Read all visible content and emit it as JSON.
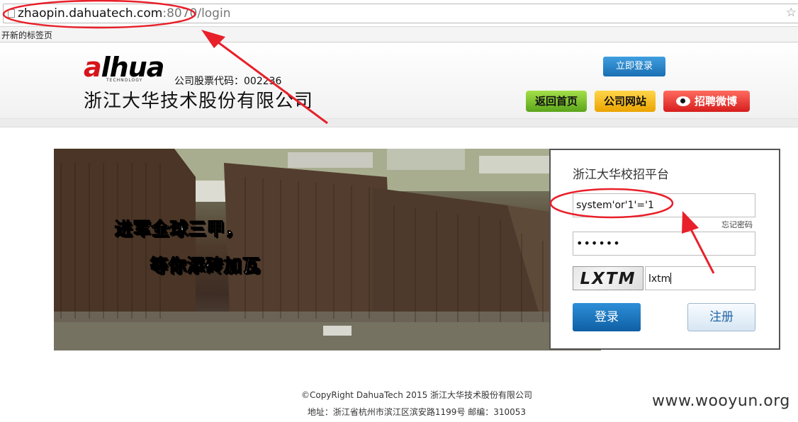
{
  "browser": {
    "url_host": "zhaopin.dahuatech.com",
    "url_rest": ":8070/login",
    "bookmark_label": "开新的标签页"
  },
  "header": {
    "logo_a": "a",
    "logo_rest": "lhua",
    "logo_sub": "TECHNOLOGY",
    "stock_code": "公司股票代码：002236",
    "company_name": "浙江大华技术股份有限公司",
    "login_now": "立即登录",
    "nav": {
      "home": "返回首页",
      "website": "公司网站",
      "weibo": "招聘微博"
    }
  },
  "hero": {
    "slogan_1": "进军全球三甲，",
    "slogan_2": "等你添砖加瓦"
  },
  "login_panel": {
    "title": "浙江大华校招平台",
    "username_value": "system'or'1'='1",
    "forgot_password": "忘记密码",
    "password_mask": "••••••",
    "captcha_image_text": "LXTM",
    "captcha_value": "lxtm",
    "login_button": "登录",
    "register_button": "注册"
  },
  "footer": {
    "copyright": "©CopyRight DahuaTech 2015 浙江大华技术股份有限公司",
    "address": "地址：浙江省杭州市滨江区滨安路1199号 邮编：310053"
  },
  "watermark": "www.wooyun.org",
  "colors": {
    "annotation_red": "#e8202a",
    "primary_blue": "#1a6fb3",
    "logo_red": "#d6151b"
  }
}
